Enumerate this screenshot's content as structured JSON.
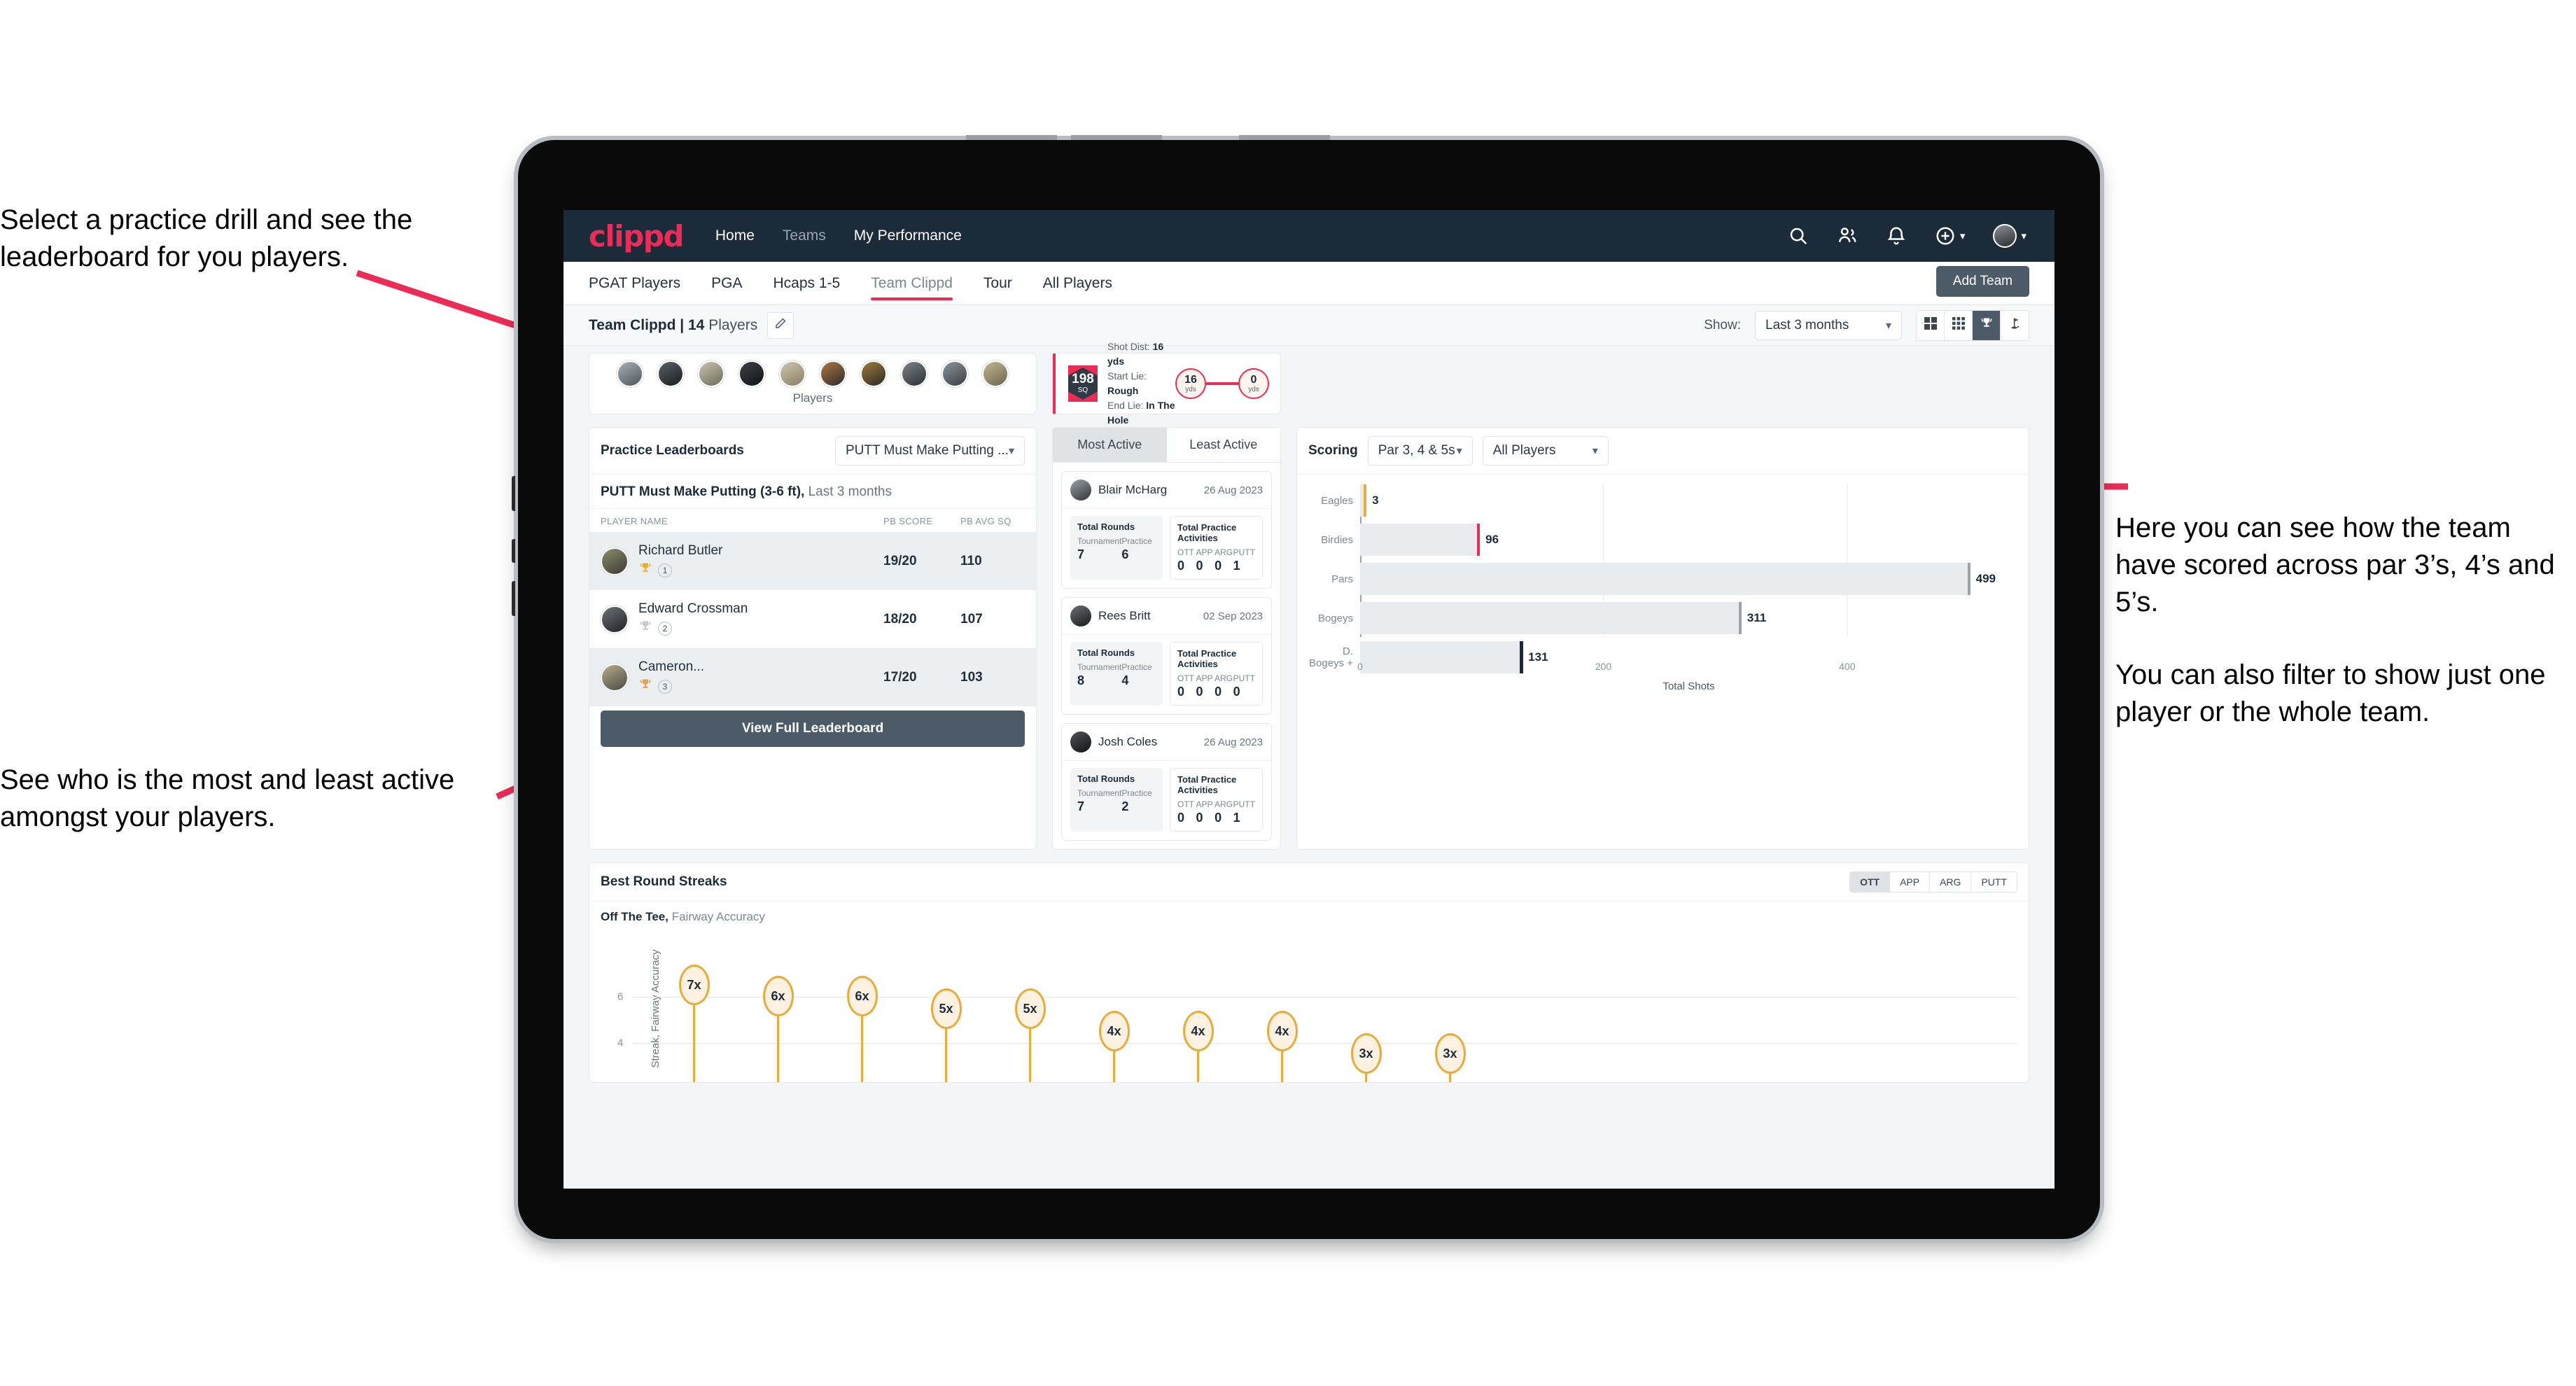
{
  "annotations": {
    "top_left": "Select a practice drill and see the leaderboard for you players.",
    "bottom_left": "See who is the most and least active amongst your players.",
    "right_1": "Here you can see how the team have scored across par 3’s, 4’s and 5’s.",
    "right_2": "You can also filter to show just one player or the whole team."
  },
  "topnav": {
    "logo": "clippd",
    "links": [
      {
        "label": "Home",
        "active": true
      },
      {
        "label": "Teams",
        "active": false
      },
      {
        "label": "My Performance",
        "active": true
      }
    ],
    "icons": [
      "search-icon",
      "people-icon",
      "bell-icon",
      "plus-circle-icon",
      "avatar"
    ]
  },
  "tabs": [
    {
      "label": "PGAT Players",
      "active": false
    },
    {
      "label": "PGA",
      "active": false
    },
    {
      "label": "Hcaps 1-5",
      "active": false
    },
    {
      "label": "Team Clippd",
      "active": true
    },
    {
      "label": "Tour",
      "active": false
    },
    {
      "label": "All Players",
      "active": false
    }
  ],
  "add_team_button": "Add Team",
  "subbar": {
    "team_name": "Team Clippd",
    "player_count": "14",
    "players_word": "Players",
    "edit_icon": "pencil-icon",
    "show_label": "Show:",
    "range_value": "Last 3 months",
    "view_buttons": [
      {
        "icon": "grid-large-icon",
        "active": false
      },
      {
        "icon": "grid-small-icon",
        "active": false
      },
      {
        "icon": "trophy-icon",
        "active": true
      },
      {
        "icon": "flag-icon",
        "active": false
      }
    ]
  },
  "players_strip": {
    "label": "Players",
    "count": 10
  },
  "shot_card": {
    "sq_value": "198",
    "sq_unit": "SQ",
    "shot_dist_label": "Shot Dist:",
    "shot_dist_value": "16 yds",
    "start_lie_label": "Start Lie:",
    "start_lie_value": "Rough",
    "end_lie_label": "End Lie:",
    "end_lie_value": "In The Hole",
    "from_value": "16",
    "from_unit": "yds",
    "to_value": "0",
    "to_unit": "yds"
  },
  "leaderboard": {
    "title": "Practice Leaderboards",
    "drill_select": "PUTT Must Make Putting ...",
    "subtitle_bold": "PUTT Must Make Putting (3-6 ft),",
    "subtitle_rest": " Last 3 months",
    "columns": [
      "PLAYER NAME",
      "PB SCORE",
      "PB AVG SQ"
    ],
    "rows": [
      {
        "name": "Richard Butler",
        "rank": "1",
        "score": "19/20",
        "avg": "110",
        "trophy": "gold"
      },
      {
        "name": "Edward Crossman",
        "rank": "2",
        "score": "18/20",
        "avg": "107",
        "trophy": "silver"
      },
      {
        "name": "Cameron...",
        "rank": "3",
        "score": "17/20",
        "avg": "103",
        "trophy": "bronze"
      }
    ],
    "view_full_button": "View Full Leaderboard"
  },
  "activity": {
    "segments": [
      {
        "label": "Most Active",
        "active": true
      },
      {
        "label": "Least Active",
        "active": false
      }
    ],
    "total_rounds_label": "Total Rounds",
    "total_practice_label": "Total Practice Activities",
    "rounds_keys": [
      "Tournament",
      "Practice"
    ],
    "practice_keys": [
      "OTT",
      "APP",
      "ARG",
      "PUTT"
    ],
    "players": [
      {
        "name": "Blair McHarg",
        "date": "26 Aug 2023",
        "tournament": "7",
        "practice": "6",
        "ott": "0",
        "app": "0",
        "arg": "0",
        "putt": "1"
      },
      {
        "name": "Rees Britt",
        "date": "02 Sep 2023",
        "tournament": "8",
        "practice": "4",
        "ott": "0",
        "app": "0",
        "arg": "0",
        "putt": "0"
      },
      {
        "name": "Josh Coles",
        "date": "26 Aug 2023",
        "tournament": "7",
        "practice": "2",
        "ott": "0",
        "app": "0",
        "arg": "0",
        "putt": "1"
      }
    ]
  },
  "scoring": {
    "title": "Scoring",
    "par_filter": "Par 3, 4 & 5s",
    "player_filter": "All Players"
  },
  "streaks": {
    "title": "Best Round Streaks",
    "toggle": [
      {
        "label": "OTT",
        "active": true
      },
      {
        "label": "APP",
        "active": false
      },
      {
        "label": "ARG",
        "active": false
      },
      {
        "label": "PUTT",
        "active": false
      }
    ],
    "sub_bold": "Off The Tee,",
    "sub_rest": " Fairway Accuracy"
  },
  "chart_data": [
    {
      "type": "bar",
      "orientation": "horizontal",
      "title": "Scoring",
      "categories": [
        "Eagles",
        "Birdies",
        "Pars",
        "Bogeys",
        "D. Bogeys +"
      ],
      "values": [
        3,
        96,
        499,
        311,
        131
      ],
      "cap_colors": [
        "#e9ab39",
        "#ec2b56",
        "#9ba3ab",
        "#9ba3ab",
        "#1c2b39"
      ],
      "xlabel": "Total Shots",
      "ylabel": "",
      "xlim": [
        0,
        540
      ],
      "xticks": [
        0,
        200,
        400
      ],
      "grid": true,
      "legend": "none"
    },
    {
      "type": "bar",
      "orientation": "vertical",
      "title": "Best Round Streaks",
      "subtitle": "Off The Tee, Fairway Accuracy",
      "ylabel": "Streak, Fairway Accuracy",
      "ylim": [
        0,
        8
      ],
      "yticks": [
        4,
        6
      ],
      "grid": true,
      "categories": [
        "",
        "",
        "",
        "",
        "",
        "",
        "",
        "",
        "",
        "",
        ""
      ],
      "values": [
        7,
        6,
        6,
        5,
        5,
        4,
        4,
        4,
        3,
        3
      ],
      "labels": [
        "7x",
        "6x",
        "6x",
        "5x",
        "5x",
        "4x",
        "4x",
        "4x",
        "3x",
        "3x"
      ],
      "marker_color": "#e9ab39",
      "legend": "none"
    }
  ]
}
